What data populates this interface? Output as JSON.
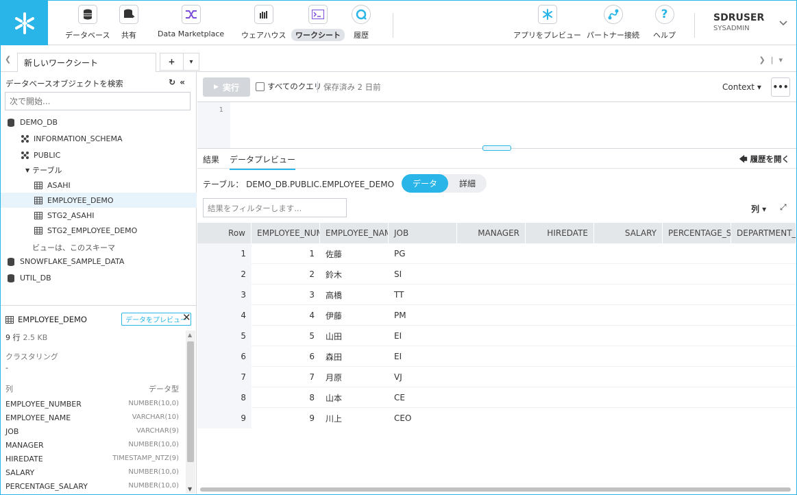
{
  "nav": {
    "items": [
      {
        "label": "データベース",
        "icon": "database-icon"
      },
      {
        "label": "共有",
        "icon": "share-icon"
      },
      {
        "label": "Data Marketplace",
        "icon": "marketplace-icon"
      },
      {
        "label": "ウェアハウス",
        "icon": "warehouse-icon"
      },
      {
        "label": "ワークシート",
        "icon": "worksheet-icon"
      },
      {
        "label": "履歴",
        "icon": "history-icon"
      },
      {
        "label": "アプリをプレビュー",
        "icon": "snowflake-icon"
      },
      {
        "label": "パートナー接続",
        "icon": "partner-icon"
      },
      {
        "label": "ヘルプ",
        "icon": "help-icon"
      }
    ],
    "user": {
      "name": "SDRUSER",
      "role": "SYSADMIN"
    },
    "accent": "#29b5e8"
  },
  "tabs": {
    "active": "新しいワークシート",
    "plus": "+",
    "dropdown": "▾"
  },
  "left": {
    "header": "データベースオブジェクトを検索",
    "search_placeholder": "次で開始...",
    "tree": [
      {
        "label": "DEMO_DB",
        "kind": "database"
      },
      {
        "label": "INFORMATION_SCHEMA",
        "kind": "schema"
      },
      {
        "label": "PUBLIC",
        "kind": "schema"
      },
      {
        "label": "テーブル",
        "kind": "folder"
      },
      {
        "label": "ASAHI",
        "kind": "table"
      },
      {
        "label": "EMPLOYEE_DEMO",
        "kind": "table"
      },
      {
        "label": "STG2_ASAHI",
        "kind": "table"
      },
      {
        "label": "STG2_EMPLOYEE_DEMO",
        "kind": "table"
      },
      {
        "label": "ビューは、このスキーマ",
        "kind": "note"
      },
      {
        "label": "SNOWFLAKE_SAMPLE_DATA",
        "kind": "database"
      },
      {
        "label": "UTIL_DB",
        "kind": "database"
      }
    ],
    "detail": {
      "name": "EMPLOYEE_DEMO",
      "preview_badge": "データをプレビュー",
      "rows": "9 行",
      "size": "2.5 KB",
      "clustering_label": "クラスタリング",
      "clustering_value": "-",
      "col_header": "列",
      "type_header": "データ型",
      "columns": [
        {
          "name": "EMPLOYEE_NUMBER",
          "type": "NUMBER(10,0)"
        },
        {
          "name": "EMPLOYEE_NAME",
          "type": "VARCHAR(10)"
        },
        {
          "name": "JOB",
          "type": "VARCHAR(9)"
        },
        {
          "name": "MANAGER",
          "type": "NUMBER(10,0)"
        },
        {
          "name": "HIREDATE",
          "type": "TIMESTAMP_NTZ(9)"
        },
        {
          "name": "SALARY",
          "type": "NUMBER(10,0)"
        },
        {
          "name": "PERCENTAGE_SALARY",
          "type": "NUMBER(10,0)"
        }
      ]
    }
  },
  "toolbar": {
    "run": "実行",
    "all_queries": "すべてのクエリ",
    "saved": "保存済み 2 日前",
    "context": "Context ▾",
    "more": "•••"
  },
  "editor": {
    "line": "1"
  },
  "results": {
    "tab_results": "結果",
    "tab_preview": "データプレビュー",
    "history": "履歴を開く",
    "table_label": "テーブル：",
    "table_name": "DEMO_DB.PUBLIC.EMPLOYEE_DEMO",
    "seg_data": "データ",
    "seg_detail": "詳細",
    "filter_placeholder": "結果をフィルターします...",
    "columns_btn": "列 ▾",
    "headers": [
      "Row",
      "EMPLOYEE_NUMBER",
      "EMPLOYEE_NAME",
      "JOB",
      "MANAGER",
      "HIREDATE",
      "SALARY",
      "PERCENTAGE_SALARY",
      "DEPARTMENT_"
    ],
    "rows": [
      {
        "row": "1",
        "num": "1",
        "name": "佐藤",
        "job": "PG"
      },
      {
        "row": "2",
        "num": "2",
        "name": "鈴木",
        "job": "SI"
      },
      {
        "row": "3",
        "num": "3",
        "name": "高橋",
        "job": "TT"
      },
      {
        "row": "4",
        "num": "4",
        "name": "伊藤",
        "job": "PM"
      },
      {
        "row": "5",
        "num": "5",
        "name": "山田",
        "job": "EI"
      },
      {
        "row": "6",
        "num": "6",
        "name": "森田",
        "job": "EI"
      },
      {
        "row": "7",
        "num": "7",
        "name": "月原",
        "job": "VJ"
      },
      {
        "row": "8",
        "num": "8",
        "name": "山本",
        "job": "CE"
      },
      {
        "row": "9",
        "num": "9",
        "name": "川上",
        "job": "CEO"
      }
    ]
  }
}
